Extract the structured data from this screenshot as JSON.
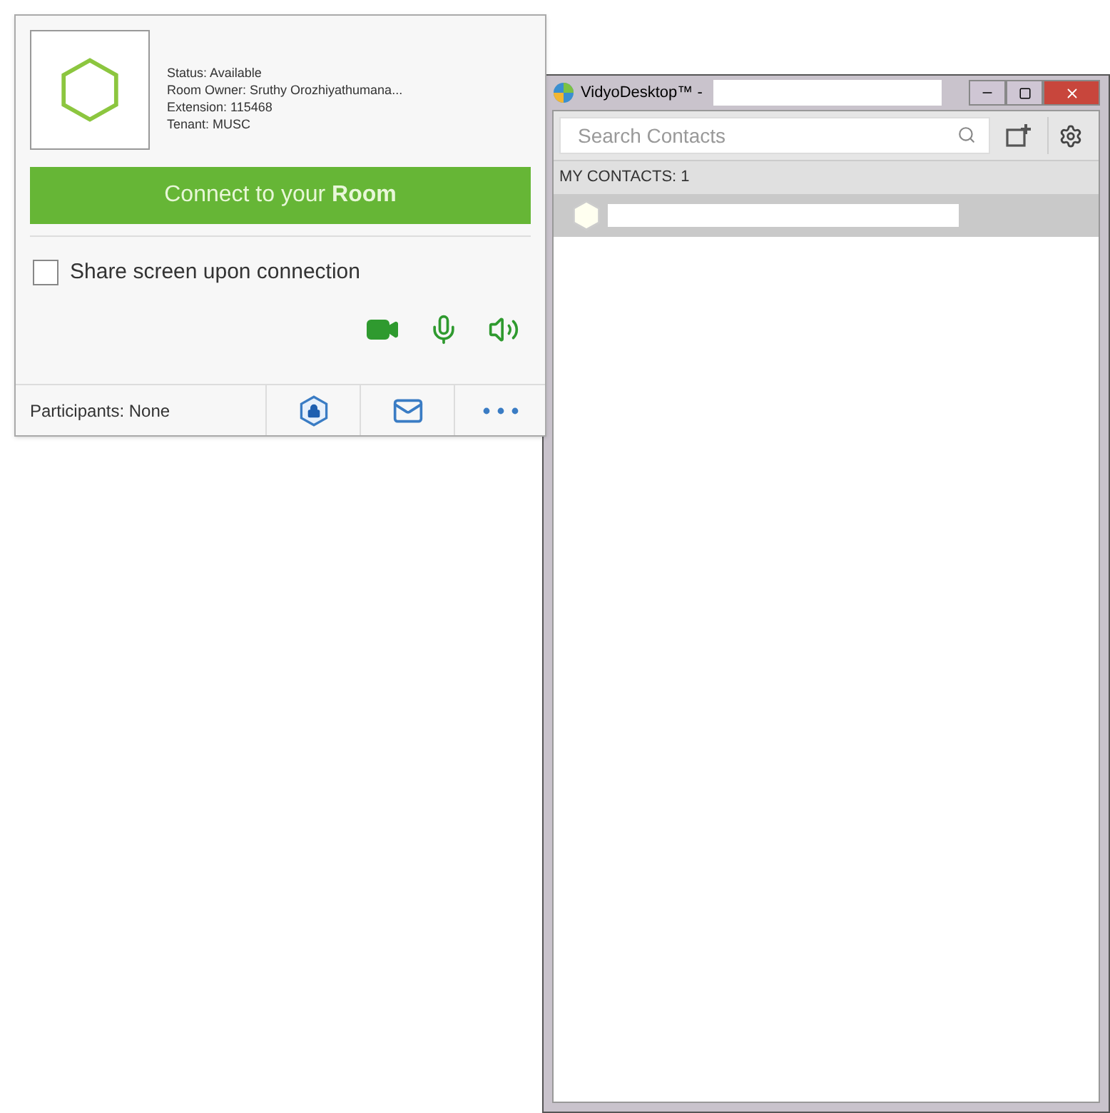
{
  "room": {
    "status": "Status: Available",
    "owner": "Room Owner: Sruthy Orozhiyathumana...",
    "extension": "Extension: 115468",
    "tenant": "Tenant: MUSC",
    "connect_button": "Connect to your **Room**",
    "share_screen": {
      "label": "Share screen upon connection",
      "checked": false
    },
    "participants": "Participants: None"
  },
  "window": {
    "title": "VidyoDesktop™ -",
    "search": {
      "placeholder": "Search Contacts"
    },
    "contacts_header": "MY CONTACTS: 1",
    "contacts": [
      {
        "selected": true
      }
    ]
  }
}
